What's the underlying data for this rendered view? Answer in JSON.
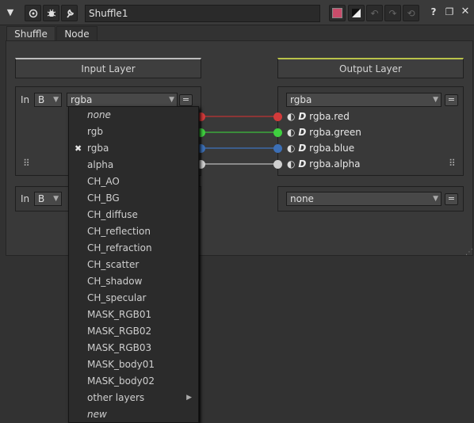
{
  "toolbar": {
    "collapse_icon": "triangle-down-icon",
    "node_name": "Shuffle1",
    "help_label": "?"
  },
  "tabs": [
    {
      "label": "Shuffle"
    },
    {
      "label": "Node"
    }
  ],
  "input": {
    "header": "Input Layer",
    "row1": {
      "in_label": "In",
      "in_value": "B",
      "layer": "rgba",
      "eq_label": "="
    },
    "row2": {
      "in_label": "In",
      "in_value": "B",
      "eq_label": "="
    }
  },
  "output": {
    "header": "Output Layer",
    "layer": "rgba",
    "eq_label": "=",
    "channels": [
      "rgba.red",
      "rgba.green",
      "rgba.blue",
      "rgba.alpha"
    ],
    "row2_value": "none",
    "row2_eq": "="
  },
  "colors": {
    "red": "#d23a3a",
    "green": "#3fcf3f",
    "blue": "#3c6fb6",
    "alpha": "#d0d0d0",
    "output_accent": "#b9c24a"
  },
  "menu": {
    "items": [
      {
        "label": "none",
        "italic": true
      },
      {
        "label": "rgb"
      },
      {
        "label": "rgba",
        "checked": true
      },
      {
        "label": "alpha"
      },
      {
        "label": "CH_AO"
      },
      {
        "label": "CH_BG"
      },
      {
        "label": "CH_diffuse"
      },
      {
        "label": "CH_reflection"
      },
      {
        "label": "CH_refraction"
      },
      {
        "label": "CH_scatter"
      },
      {
        "label": "CH_shadow"
      },
      {
        "label": "CH_specular"
      },
      {
        "label": "MASK_RGB01"
      },
      {
        "label": "MASK_RGB02"
      },
      {
        "label": "MASK_RGB03"
      },
      {
        "label": "MASK_body01"
      },
      {
        "label": "MASK_body02"
      },
      {
        "label": "other layers",
        "submenu": true
      },
      {
        "label": "new",
        "italic": true
      }
    ]
  }
}
